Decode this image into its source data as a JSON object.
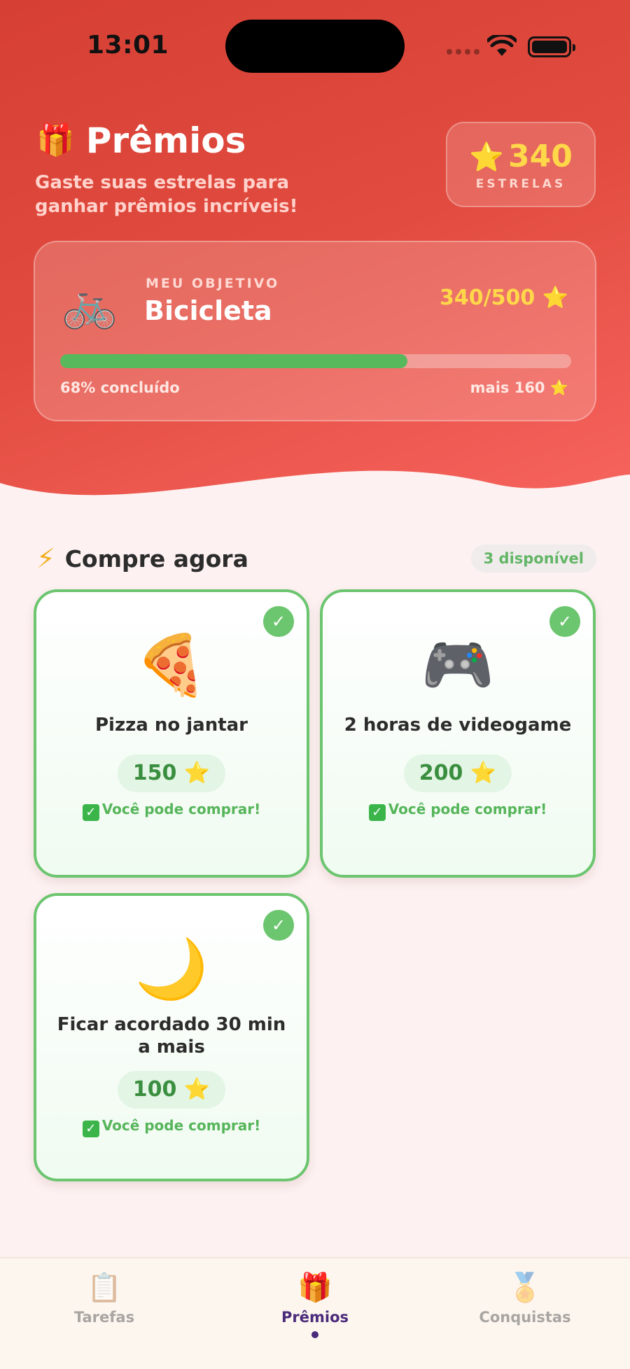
{
  "status_bar": {
    "time": "13:01"
  },
  "header": {
    "title_icon": "🎁",
    "title": "Prêmios",
    "subtitle": "Gaste suas estrelas para ganhar prêmios incríveis!",
    "stars_value": "340",
    "stars_label": "ESTRELAS"
  },
  "goal": {
    "emoji": "🚲",
    "kicker": "MEU OBJETIVO",
    "name": "Bicicleta",
    "progress_text": "340/500 ⭐",
    "progress_fraction": 0.68,
    "percent_text": "68% concluído",
    "remaining_text": "mais 160 ⭐"
  },
  "section": {
    "icon": "⚡",
    "title": "Compre agora",
    "available": "3 disponível"
  },
  "rewards": [
    {
      "emoji": "🍕",
      "name": "Pizza no jantar",
      "price": "150 ⭐",
      "status": "Você pode comprar!"
    },
    {
      "emoji": "🎮",
      "name": "2 horas de videogame",
      "price": "200 ⭐",
      "status": "Você pode comprar!"
    },
    {
      "emoji": "🌙",
      "name": "Ficar acordado 30 min a mais",
      "price": "100 ⭐",
      "status": "Você pode comprar!"
    }
  ],
  "tabs": [
    {
      "icon": "📋",
      "label": "Tarefas"
    },
    {
      "icon": "🎁",
      "label": "Prêmios",
      "active": true
    },
    {
      "icon": "🏅",
      "label": "Conquistas"
    }
  ],
  "colors": {
    "hero_start": "#d63f33",
    "hero_end": "#f7645e",
    "accent_green": "#6cc56f",
    "star_yellow": "#ffd84a",
    "active_tab": "#4a2a7a"
  },
  "icons": {
    "wifi": "wifi-icon",
    "battery": "battery-icon",
    "check": "check-icon"
  }
}
